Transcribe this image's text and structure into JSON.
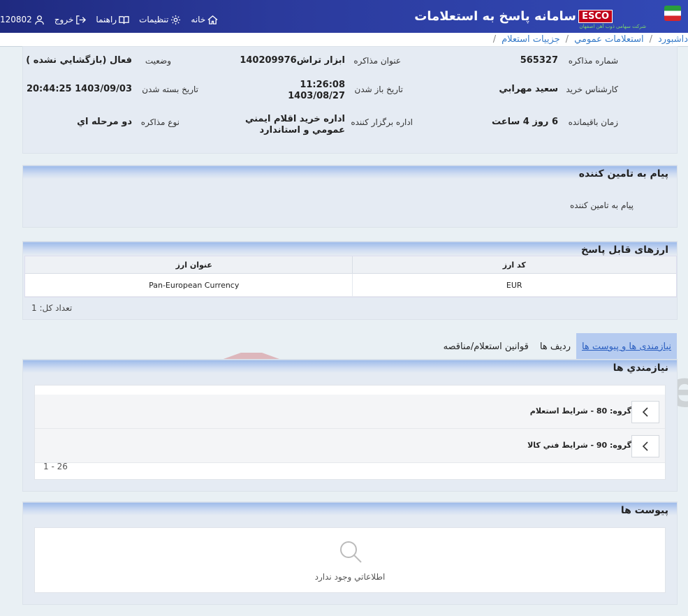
{
  "header": {
    "app_title": "سامانه پاسخ به استعلامات",
    "brand": "ESCO",
    "brand_sub": "شرکت سهامی ذوب آهن اصفهان",
    "nav": {
      "home": "خانه",
      "settings": "تنظیمات",
      "guide": "راهنما",
      "logout": "خروج",
      "user_id": "120802"
    }
  },
  "breadcrumb": [
    "داشبورد",
    "استعلامات عمومي",
    "جزييات استعلام"
  ],
  "info": {
    "negotiation_number_label": "شماره مذاکره",
    "negotiation_number": "565327",
    "negotiation_title_label": "عنوان مذاکره",
    "negotiation_title": "ابزار تراش140209976",
    "status_label": "وضعیت",
    "status": "فعال (بازگشايي نشده )",
    "purchase_expert_label": "كارشناس خريد",
    "purchase_expert": "سعيد مهرابي",
    "opening_date_label": "تاريخ باز شدن",
    "opening_time": "11:26:08",
    "opening_date": "1403/08/27",
    "closing_date_label": "تاريخ بسته شدن",
    "closing_date": "1403/09/03 20:44:25",
    "remaining_label": "زمان باقيمانده",
    "remaining": "6 روز 4 ساعت",
    "organizer_label": "اداره برگزار كننده",
    "organizer_line1": "اداره خريد اقلام ايمني",
    "organizer_line2": "عمومي و استاندارد",
    "type_label": "نوع مذاكره",
    "type": "دو مرحله اي"
  },
  "message": {
    "title": "پیام به تامین کننده",
    "body": "پيام به تامين كننده"
  },
  "currencies": {
    "title": "ارزهای قابل پاسخ",
    "columns": [
      "كد ارز",
      "عنوان ارز"
    ],
    "rows": [
      [
        "EUR",
        "Pan-European Currency"
      ]
    ],
    "count_label": "تعداد كل: 1"
  },
  "tabs": [
    "نیازمندی ها و پیوست ها",
    "رديف ها",
    "قوانين استعلام/مناقصه"
  ],
  "needs": {
    "title": "نیازمندي ها",
    "groups": [
      "گروه: 80 - شرايط استعلام",
      "گروه: 90 - شرايط فني كالا"
    ],
    "pager": "1 - 26"
  },
  "attachments": {
    "title": "پیوست ها",
    "empty": "اطلاعاتي وجود ندارد"
  },
  "watermark": "AriaTender.neT",
  "colors": {
    "header_bg": "#2b3a9c",
    "accent_link": "#3a7dc9",
    "card_bg": "#e5ebf3",
    "card_head": "#9ebcea"
  }
}
